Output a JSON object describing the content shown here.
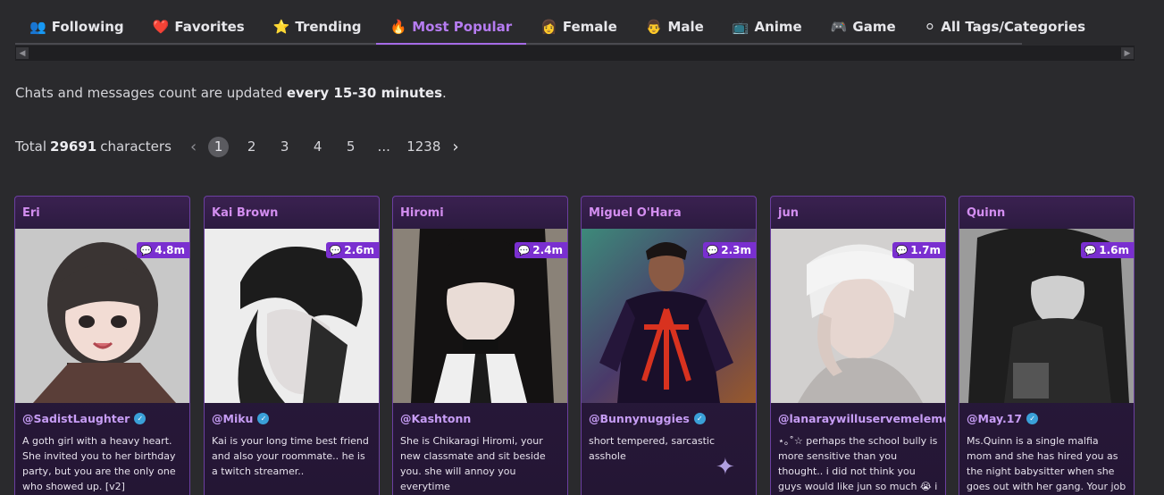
{
  "tabs": [
    {
      "label": "Following",
      "icon": "👥"
    },
    {
      "label": "Favorites",
      "icon": "❤️"
    },
    {
      "label": "Trending",
      "icon": "⭐"
    },
    {
      "label": "Most Popular",
      "icon": "🔥"
    },
    {
      "label": "Female",
      "icon": "👩"
    },
    {
      "label": "Male",
      "icon": "👨"
    },
    {
      "label": "Anime",
      "icon": "📺"
    },
    {
      "label": "Game",
      "icon": "🎮"
    },
    {
      "label": "All Tags/Categories",
      "icon": "⚪"
    }
  ],
  "notice": {
    "prefix": "Chats and messages count are updated ",
    "bold": "every 15-30 minutes",
    "suffix": "."
  },
  "total": {
    "prefix": "Total",
    "count": "29691",
    "suffix": "characters"
  },
  "pagination": {
    "pages": [
      "1",
      "2",
      "3",
      "4",
      "5",
      "...",
      "1238"
    ],
    "current": "1"
  },
  "cards": [
    {
      "name": "Eri",
      "count": "4.8m",
      "creator": "@SadistLaughter",
      "desc": "A goth girl with a heavy heart. She invited you to her birthday party, but you are the only one who showed up. [v2]"
    },
    {
      "name": "Kai Brown",
      "count": "2.6m",
      "creator": "@Miku",
      "desc": "Kai is your long time best friend and also your roommate.. he is a twitch streamer.."
    },
    {
      "name": "Hiromi",
      "count": "2.4m",
      "creator": "@Kashtonn",
      "desc": "She is Chikaragi Hiromi, your new classmate and sit beside you. she will annoy you everytime"
    },
    {
      "name": "Miguel O'Hara",
      "count": "2.3m",
      "creator": "@Bunnynuggies",
      "desc": "short tempered, sarcastic asshole"
    },
    {
      "name": "jun",
      "count": "1.7m",
      "creator": "@lanaraywilluservemelemonade",
      "desc": "⋆｡˚☆ perhaps the school bully is more sensitive than you thought.. i did not think you guys would like jun so much 😭 i have"
    },
    {
      "name": "Quinn",
      "count": "1.6m",
      "creator": "@May.17",
      "desc": "Ms.Quinn is a single malfia mom and she has hired you as the night babysitter when she goes out with her gang. Your job is to babysit"
    }
  ]
}
